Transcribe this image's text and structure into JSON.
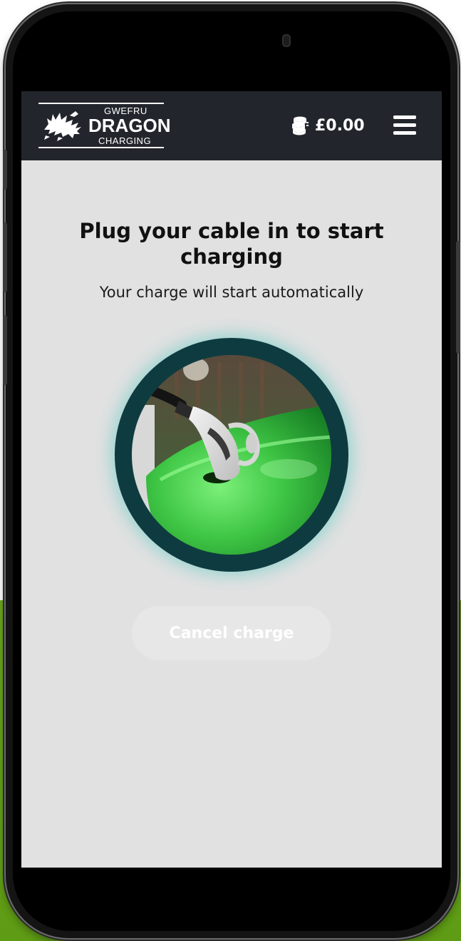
{
  "header": {
    "logo": {
      "top_text": "GWEFRU",
      "main_text": "DRAGON",
      "bottom_text": "CHARGING"
    },
    "balance": {
      "icon": "coins-icon",
      "amount": "£0.00"
    },
    "menu_icon": "hamburger-menu-icon"
  },
  "main": {
    "title": "Plug your cable in to start charging",
    "subtitle": "Your charge will start automatically",
    "image_subject": "ev-charger-plug",
    "cancel_label": "Cancel charge"
  },
  "colors": {
    "header_bg": "#22262c",
    "screen_bg": "#e1e1e1",
    "ring": "#0e3b40",
    "ring_glow": "#46c8be",
    "accent_green": "#6aa81c",
    "button_bg": "#e7e7e7",
    "button_text": "#ffffff"
  }
}
